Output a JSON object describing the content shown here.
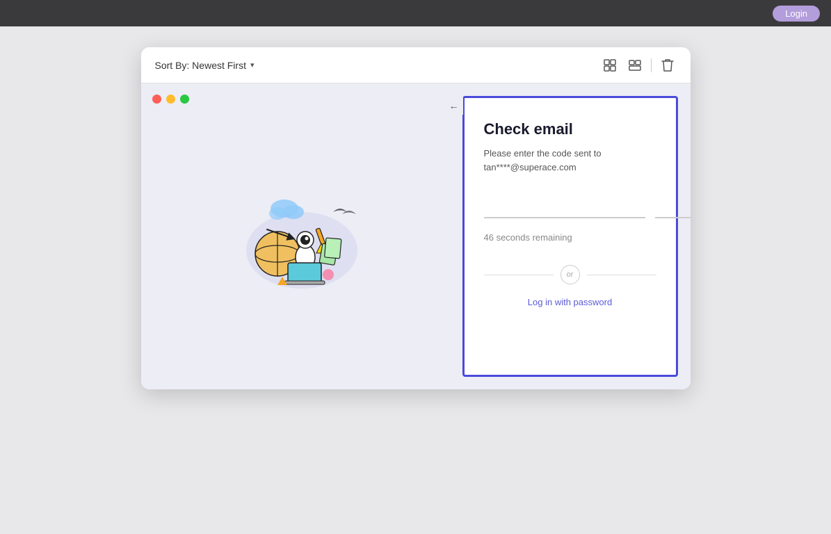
{
  "topbar": {
    "login_label": "Login"
  },
  "toolbar": {
    "sort_label": "Sort By: Newest First",
    "chevron": "▾",
    "grid_icon": "⊞",
    "list_icon": "⊟",
    "trash_icon": "🗑"
  },
  "check_email": {
    "title": "Check email",
    "description": "Please enter the code sent to tan****@superace.com",
    "timer": "46 seconds remaining",
    "log_in_link": "Log in with password",
    "or_label": "or",
    "back_arrow": "←"
  }
}
